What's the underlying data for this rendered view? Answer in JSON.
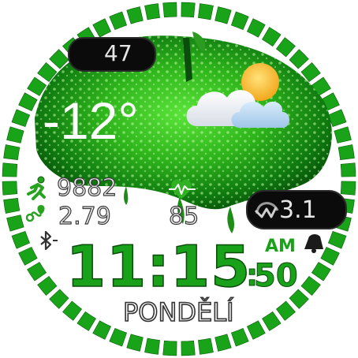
{
  "battery": {
    "level": "47",
    "icon": "battery-icon"
  },
  "weather": {
    "temperature": "-12°",
    "condition_icon": "partly-cloudy-icon"
  },
  "activity": {
    "steps": "9882",
    "steps_icon": "running-person-icon",
    "distance": "2.79",
    "distance_icon": "route-icon",
    "heart_rate": "85",
    "heart_icon": "heart-pulse-icon"
  },
  "wave_metric": {
    "value": "3.1",
    "icon": "wave-icon"
  },
  "status": {
    "bluetooth_icon": "bluetooth-icon",
    "alarm_icon": "alarm-bell-icon"
  },
  "time": {
    "hours_minutes": "11:15",
    "colon": ":",
    "seconds": "50",
    "ampm": "AM"
  },
  "date": {
    "weekday": "PONDĚLÍ"
  },
  "colors": {
    "accent_green": "#1fa51f",
    "dark_green": "#0b5e0b",
    "light_green": "#6fd04f",
    "ring_green": "#19a319"
  }
}
